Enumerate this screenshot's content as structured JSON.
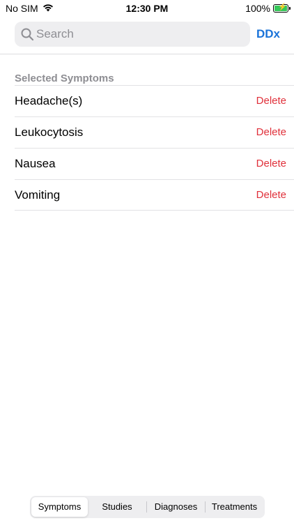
{
  "status_bar": {
    "carrier": "No SIM",
    "time": "12:30 PM",
    "battery_percent": "100%",
    "battery_color": "#34c759"
  },
  "search": {
    "placeholder": "Search",
    "value": ""
  },
  "ddx_label": "DDx",
  "section_header": "Selected Symptoms",
  "symptoms": [
    {
      "name": "Headache(s)",
      "action": "Delete"
    },
    {
      "name": "Leukocytosis",
      "action": "Delete"
    },
    {
      "name": "Nausea",
      "action": "Delete"
    },
    {
      "name": "Vomiting",
      "action": "Delete"
    }
  ],
  "tabs": [
    {
      "label": "Symptoms",
      "selected": true
    },
    {
      "label": "Studies",
      "selected": false
    },
    {
      "label": "Diagnoses",
      "selected": false
    },
    {
      "label": "Treatments",
      "selected": false
    }
  ],
  "colors": {
    "accent": "#1a73d9",
    "destructive": "#e0303a",
    "secondary_text": "#8e8e93"
  }
}
